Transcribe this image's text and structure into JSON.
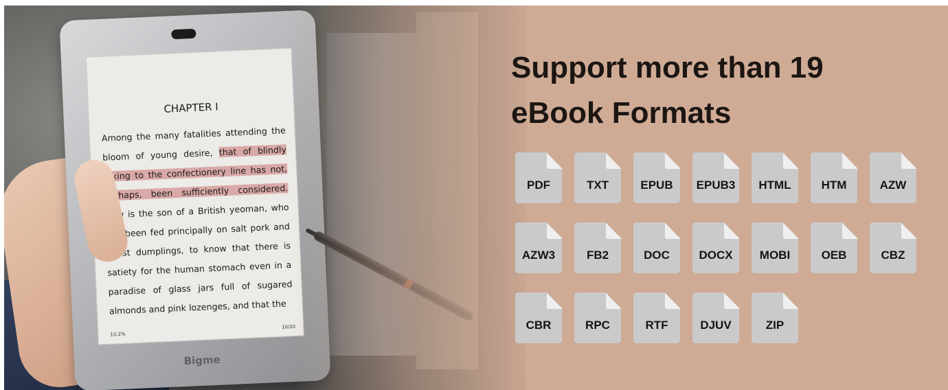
{
  "headline": {
    "line1": "Support more than 19",
    "line2": "eBook Formats"
  },
  "device": {
    "brand": "Bigme",
    "chapter_title": "CHAPTER I",
    "text_before_highlight": "Among the many fatalities attending the bloom of young desire, ",
    "highlighted_text": "that of blindly taking to the confectionery line has not, perhaps, been sufficiently considered.",
    "text_after_highlight": " How is the son of a British yeoman, who has been fed principally on salt pork and yeast dumplings, to know that there is satiety for the human stomach even in a paradise of glass jars full of sugared almonds and pink lozenges, and that the",
    "page_left": "10.2%",
    "page_right": "10/20"
  },
  "formats": [
    "PDF",
    "TXT",
    "EPUB",
    "EPUB3",
    "HTML",
    "HTM",
    "AZW",
    "AZW3",
    "FB2",
    "DOC",
    "DOCX",
    "MOBI",
    "OEB",
    "CBZ",
    "CBR",
    "RPC",
    "RTF",
    "DJUV",
    "ZIP"
  ],
  "colors": {
    "background": "#cfab95",
    "file_icon": "#cacaca",
    "highlight": "#d9a9a7",
    "headline": "#1c1613"
  }
}
